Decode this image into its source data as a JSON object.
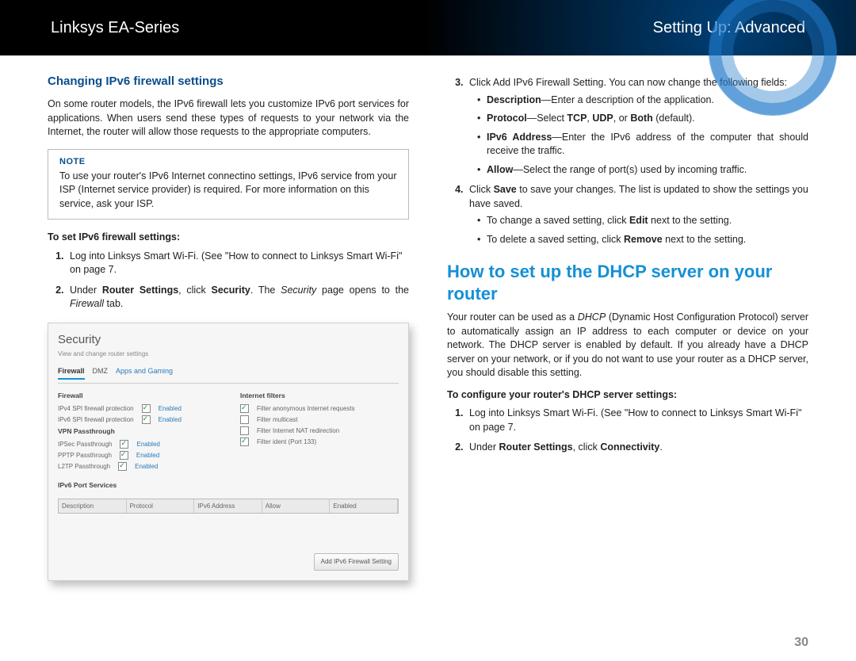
{
  "header": {
    "left": "Linksys EA-Series",
    "right": "Setting Up: Advanced"
  },
  "left": {
    "h3": "Changing IPv6 firewall settings",
    "intro": "On some router models, the IPv6 firewall lets you customize IPv6 port services for applications. When users send these types of requests to your network via the Internet, the router will allow those requests to the appropriate computers.",
    "note_title": "NOTE",
    "note_body": "To use your router's IPv6 Internet connectino settings, IPv6 service from your ISP (Internet service provider) is required. For more information on this service, ask your ISP.",
    "subhead": "To set IPv6 firewall settings:",
    "step1": "Log into Linksys Smart Wi-Fi. (See \"How to connect to Linksys Smart Wi-Fi\" on page 7.",
    "step2_pre": "Under ",
    "step2_b1": "Router Settings",
    "step2_mid": ", click ",
    "step2_b2": "Security",
    "step2_post1": ". The ",
    "step2_i": "Security",
    "step2_post2": " page opens to the ",
    "step2_i2": "Firewall",
    "step2_end": " tab."
  },
  "screenshot": {
    "title": "Security",
    "sub": "View and change router settings",
    "tabs": [
      "Firewall",
      "DMZ",
      "Apps and Gaming"
    ],
    "firewall_title": "Firewall",
    "fw_rows": [
      {
        "label": "IPv4 SPI firewall protection",
        "state": "Enabled"
      },
      {
        "label": "IPv6 SPI firewall protection",
        "state": "Enabled"
      }
    ],
    "vpn_title": "VPN Passthrough",
    "vpn_rows": [
      {
        "label": "IPSec Passthrough",
        "state": "Enabled"
      },
      {
        "label": "PPTP Passthrough",
        "state": "Enabled"
      },
      {
        "label": "L2TP Passthrough",
        "state": "Enabled"
      }
    ],
    "ifilters_title": "Internet filters",
    "ifilters": [
      {
        "label": "Filter anonymous Internet requests",
        "on": true
      },
      {
        "label": "Filter multicast",
        "on": false
      },
      {
        "label": "Filter Internet NAT redirection",
        "on": false
      },
      {
        "label": "Filter ident (Port 133)",
        "on": true
      }
    ],
    "ipv6_title": "IPv6 Port Services",
    "cols": [
      "Description",
      "Protocol",
      "IPv6 Address",
      "Allow",
      "Enabled"
    ],
    "btn": "Add IPv6 Firewall Setting"
  },
  "right": {
    "step3_intro": "Click Add IPv6 Firewall Setting. You can now change the following fields:",
    "s3_desc_b": "Description",
    "s3_desc_t": "—Enter a description of the application.",
    "s3_proto_b": "Protocol",
    "s3_proto_mid": "—Select ",
    "s3_proto_b2": "TCP",
    "s3_proto_c": ", ",
    "s3_proto_b3": "UDP",
    "s3_proto_or": ", or ",
    "s3_proto_b4": "Both",
    "s3_proto_end": " (default).",
    "s3_ipv6_b": "IPv6 Address",
    "s3_ipv6_t": "—Enter the IPv6 address of the computer that should receive the traffic.",
    "s3_allow_b": "Allow",
    "s3_allow_t": "—Select the range of port(s) used by incoming traffic.",
    "step4_pre": "Click ",
    "step4_b": "Save",
    "step4_post": " to save your changes. The list is updated to show the settings you have saved.",
    "s4_edit_pre": "To change a saved setting, click ",
    "s4_edit_b": "Edit",
    "s4_edit_post": " next to the setting.",
    "s4_del_pre": "To delete a saved setting, click ",
    "s4_del_b": "Remove",
    "s4_del_post": " next to the setting.",
    "h2": "How to set up the DHCP server on your router",
    "dhcp_intro_pre": "Your router can be used as a ",
    "dhcp_intro_i": "DHCP",
    "dhcp_intro_post": " (Dynamic Host Configuration Protocol) server to automatically assign an IP address to each computer or device on your network. The DHCP server is enabled by default. If you already have a DHCP server on your network, or if you do not want to use your router as a DHCP server, you should disable this setting.",
    "dhcp_subhead": "To configure your router's DHCP server settings:",
    "dhcp_s1": "Log into Linksys Smart Wi-Fi. (See \"How to connect to Linksys Smart Wi-Fi\" on page 7.",
    "dhcp_s2_pre": "Under ",
    "dhcp_s2_b1": "Router Settings",
    "dhcp_s2_mid": ", click ",
    "dhcp_s2_b2": "Connectivity",
    "dhcp_s2_end": "."
  },
  "page_number": "30"
}
